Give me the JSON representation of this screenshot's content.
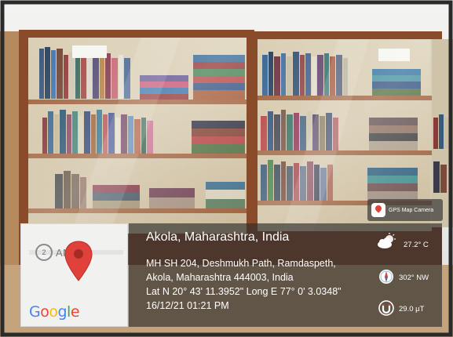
{
  "badge": {
    "app_name": "GPS Map Camera",
    "icon": "gps-map-camera-app-icon"
  },
  "map": {
    "place_label": "AMDA",
    "ring_label": "2",
    "brand": "Google",
    "pin_icon": "location-pin-icon",
    "pin_color": "#e0413a"
  },
  "location": {
    "title": "Akola, Maharashtra, India",
    "address_lines": [
      "MH SH 204, Deshmukh Path, Ramdaspeth,",
      "Akola, Maharashtra 444003, India",
      "Lat N 20° 43' 11.3952\" Long E 77° 0' 3.0348\"",
      "16/12/21 01:21 PM"
    ]
  },
  "metrics": [
    {
      "icon": "cloud-sun-icon",
      "value": "27.2° C"
    },
    {
      "icon": "compass-icon",
      "value": "302° NW"
    },
    {
      "icon": "magnet-icon",
      "value": "29.0 µT"
    }
  ],
  "colors": {
    "overlay": "#2d2d2d",
    "cabinet_frame": "#8a4b2a",
    "wall": "#eef0ee"
  }
}
